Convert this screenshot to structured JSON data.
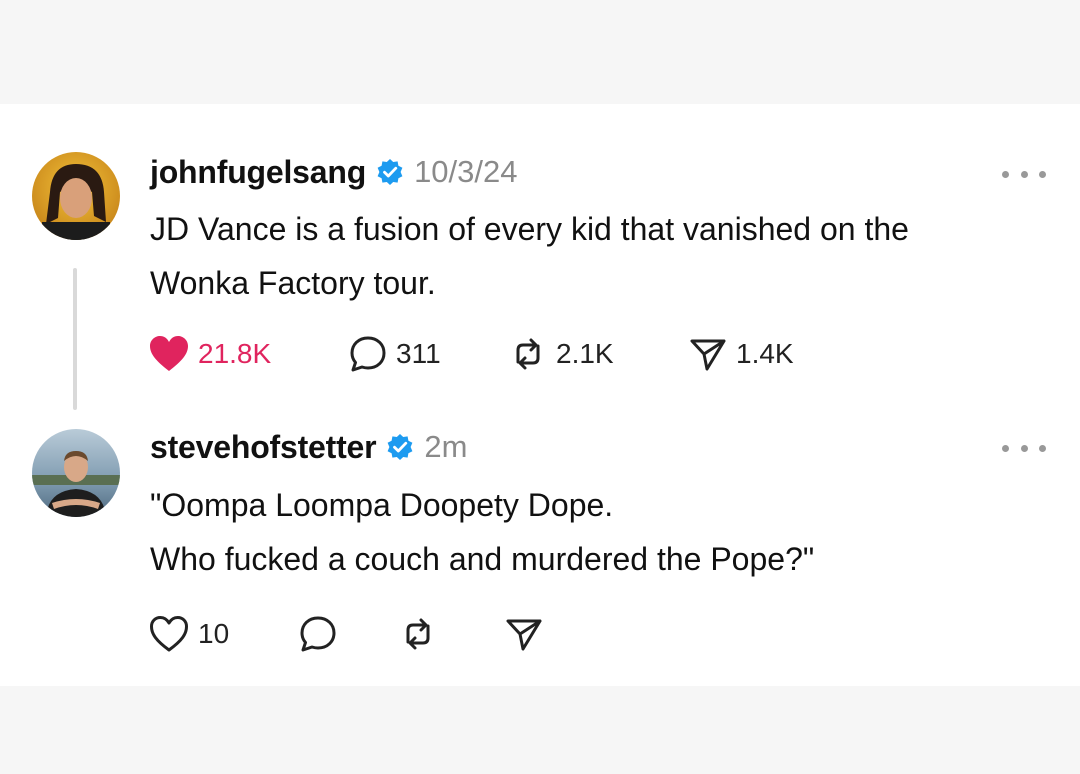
{
  "posts": [
    {
      "username": "johnfugelsang",
      "timestamp": "10/3/24",
      "text_lines": [
        "JD Vance is a fusion of every kid that vanished on the",
        "Wonka Factory tour."
      ],
      "liked": true,
      "likes": "21.8K",
      "replies": "311",
      "reposts": "2.1K",
      "shares": "1.4K"
    },
    {
      "username": "stevehofstetter",
      "timestamp": "2m",
      "text_lines": [
        "\"Oompa Loompa Doopety Dope.",
        "Who fucked a couch and murdered the Pope?\""
      ],
      "liked": false,
      "likes": "10",
      "replies": "",
      "reposts": "",
      "shares": ""
    }
  ],
  "icons": {
    "verified": "verified-badge-icon",
    "more": "more-options-icon",
    "like": "heart-icon",
    "reply": "speech-bubble-icon",
    "repost": "repost-arrows-icon",
    "share": "paper-plane-icon"
  },
  "colors": {
    "like_active": "#e0245e",
    "verified": "#1d9bf0",
    "muted": "#8a8a8a",
    "thread_line": "#d9d9d9"
  }
}
